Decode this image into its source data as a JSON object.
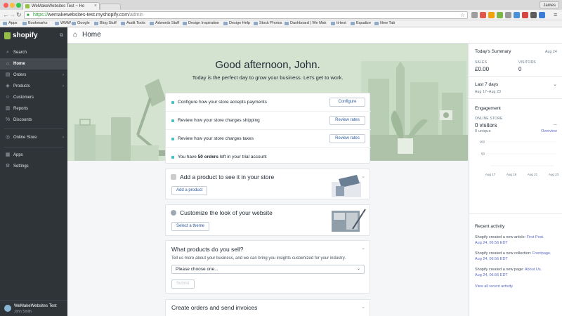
{
  "browser": {
    "tab_title": "WeMakeWebsites Test ~ Ho",
    "user": "James",
    "url_scheme": "https://",
    "url_host": "wemakewebsites-test.myshopify.com",
    "url_path": "/admin",
    "bookmarks": [
      "Apps",
      "Bookmarks",
      "WMW",
      "Google",
      "Blog Stuff",
      "Audit Tools",
      "Adwords Stuff",
      "Design Inspiration",
      "Design Help",
      "Stock Photos",
      "Dashboard | We Mak",
      "tt-test",
      "Equalize",
      "New Tab"
    ]
  },
  "sidebar": {
    "brand": "shopify",
    "items": [
      {
        "label": "Search",
        "icon": "⌕"
      },
      {
        "label": "Home",
        "icon": "⌂"
      },
      {
        "label": "Orders",
        "icon": "▤"
      },
      {
        "label": "Products",
        "icon": "◈"
      },
      {
        "label": "Customers",
        "icon": "☺"
      },
      {
        "label": "Reports",
        "icon": "▥"
      },
      {
        "label": "Discounts",
        "icon": "%"
      },
      {
        "label": "Online Store",
        "icon": "◎"
      },
      {
        "label": "Apps",
        "icon": "▦"
      },
      {
        "label": "Settings",
        "icon": "⚙"
      }
    ],
    "account_shop": "WeMakeWebsites Test",
    "account_user": "John Smith"
  },
  "topbar": {
    "title": "Home"
  },
  "hero": {
    "greeting": "Good afternoon, John.",
    "subtitle": "Today is the perfect day to grow your business. Let's get to work."
  },
  "tasks": [
    {
      "text": "Configure how your store accepts payments",
      "button": "Configure"
    },
    {
      "text": "Review how your store charges shipping",
      "button": "Review rates"
    },
    {
      "text": "Review how your store charges taxes",
      "button": "Review rates"
    },
    {
      "text_prefix": "You have ",
      "text_bold": "50 orders",
      "text_suffix": " left in your trial account"
    }
  ],
  "cards": {
    "add_product": {
      "title": "Add a product to see it in your store",
      "button": "Add a product"
    },
    "customize": {
      "title": "Customize the look of your website",
      "button": "Select a theme"
    },
    "products_sell": {
      "title": "What products do you sell?",
      "desc": "Tell us more about your business, and we can bring you insights customized for your industry.",
      "select_value": "Please choose one...",
      "submit": "Submit"
    },
    "orders": {
      "title": "Create orders and send invoices"
    }
  },
  "summary": {
    "title": "Today's Summary",
    "date": "Aug 24",
    "sales_label": "SALES",
    "sales_value": "£0.00",
    "visitors_label": "VISITORS",
    "visitors_value": "0",
    "range_title": "Last 7 days",
    "range_dates": "Aug 17–Aug 23",
    "engagement_title": "Engagement",
    "online_store_label": "ONLINE STORE",
    "visitors_count": "0 visitors",
    "dash": "—",
    "unique": "0 unique",
    "overview": "Overview"
  },
  "chart_data": {
    "type": "line",
    "categories": [
      "Aug 17",
      "Aug 19",
      "Aug 21",
      "Aug 23"
    ],
    "y_ticks": [
      100,
      50
    ],
    "values": [
      0,
      0,
      0,
      0
    ],
    "ylim": [
      0,
      100
    ]
  },
  "activity": {
    "title": "Recent activity",
    "items": [
      {
        "text": "Shopify created a new article: ",
        "link": "First Post.",
        "time": "Aug 24, 06:56 EDT"
      },
      {
        "text": "Shopify created a new collection: ",
        "link": "Frontpage.",
        "time": "Aug 24, 06:56 EDT"
      },
      {
        "text": "Shopify created a new page: ",
        "link": "About Us.",
        "time": "Aug 24, 06:56 EDT"
      }
    ],
    "view_all": "View all recent activity"
  },
  "colors": {
    "sidebar_bg": "#2e3438",
    "hero_bg": "#d3e3d0",
    "accent_green": "#95bf47",
    "link": "#5c6ac4",
    "task_dot": "#47c1bf"
  }
}
